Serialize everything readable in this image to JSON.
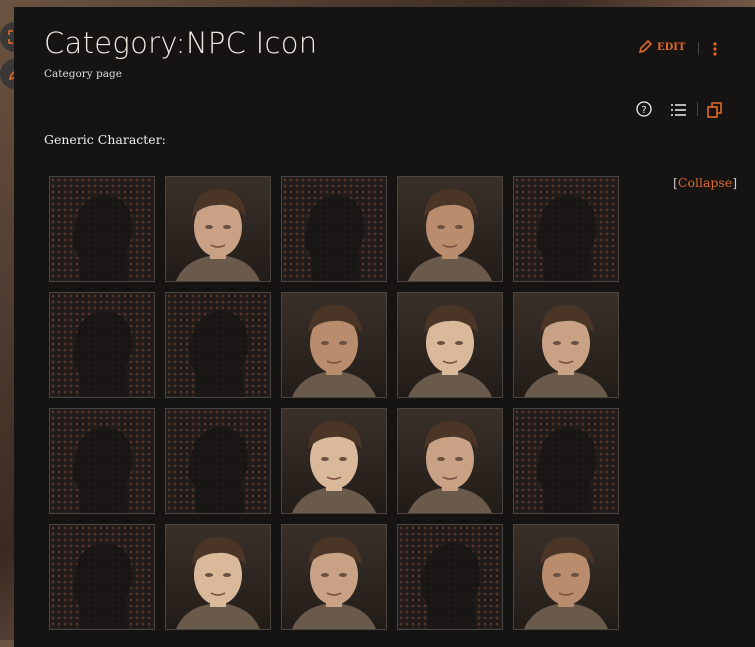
{
  "page": {
    "title": "Category:NPC Icon",
    "subtitle": "Category page",
    "edit_label": "EDIT",
    "section_heading": "Generic Character:",
    "collapse_open": "[",
    "collapse_label": "Collapse",
    "collapse_close": "]"
  },
  "icons": [
    "fullscreen-icon",
    "pencil-icon",
    "more-vertical-icon",
    "help-icon",
    "list-icon",
    "copy-icon"
  ],
  "colors": {
    "accent": "#e0692a",
    "panel": "#161413"
  },
  "tiles": [
    [
      "silhouette",
      "portrait",
      "silhouette",
      "portrait",
      "silhouette"
    ],
    [
      "silhouette",
      "silhouette",
      "portrait",
      "portrait",
      "portrait"
    ],
    [
      "silhouette",
      "silhouette",
      "portrait",
      "portrait",
      "silhouette"
    ],
    [
      "silhouette",
      "portrait",
      "portrait",
      "silhouette",
      "portrait"
    ]
  ]
}
